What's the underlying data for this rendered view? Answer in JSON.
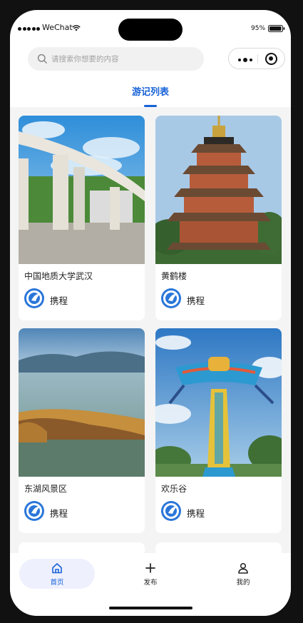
{
  "status_bar": {
    "carrier": "WeChat",
    "battery": "95%"
  },
  "search": {
    "placeholder": "请搜索你想要的内容"
  },
  "tabs": {
    "active_label": "游记列表"
  },
  "colors": {
    "accent": "#1762d8",
    "page_bg": "#f4f4f4",
    "nav_active_bg": "#eef0fd"
  },
  "cards": [
    {
      "title": "中国地质大学武汉",
      "author": "携程",
      "image": "university-gate-photo"
    },
    {
      "title": "黄鹤楼",
      "author": "携程",
      "image": "yellow-crane-tower-photo"
    },
    {
      "title": "东湖风景区",
      "author": "携程",
      "image": "east-lake-photo"
    },
    {
      "title": "欢乐谷",
      "author": "携程",
      "image": "amusement-ride-photo"
    }
  ],
  "nav": {
    "items": [
      {
        "label": "首页",
        "icon": "home-icon"
      },
      {
        "label": "发布",
        "icon": "plus-icon"
      },
      {
        "label": "我的",
        "icon": "user-icon"
      }
    ]
  }
}
